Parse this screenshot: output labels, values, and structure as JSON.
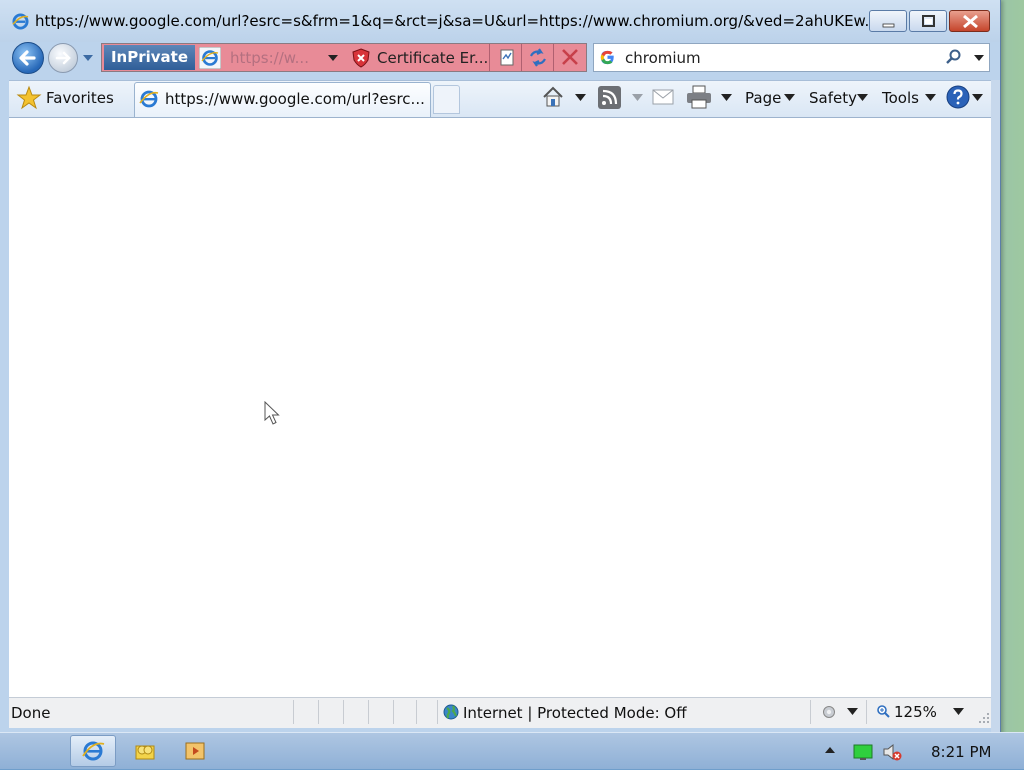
{
  "window": {
    "title": "https://www.google.com/url?esrc=s&frm=1&q=&rct=j&sa=U&url=https://www.chromium.org/&ved=2ahUKEw..."
  },
  "addressbar": {
    "inprivate_label": "InPrivate",
    "url": "https://w...",
    "cert_error": "Certificate Er..."
  },
  "search": {
    "value": "chromium"
  },
  "commandbar": {
    "favorites_label": "Favorites",
    "tab_label": "https://www.google.com/url?esrc...",
    "page_label": "Page",
    "safety_label": "Safety",
    "tools_label": "Tools"
  },
  "statusbar": {
    "status": "Done",
    "zone": "Internet | Protected Mode: Off",
    "zoom": "125%"
  },
  "taskbar": {
    "time": "8:21 PM"
  },
  "icons": [
    "ie-icon",
    "minimize-icon",
    "maximize-icon",
    "close-icon",
    "back-icon",
    "forward-icon",
    "certificate-error-icon",
    "compatibility-view-icon",
    "refresh-icon",
    "stop-icon",
    "google-icon",
    "search-icon",
    "star-icon",
    "home-icon",
    "rss-icon",
    "mail-icon",
    "print-icon",
    "help-icon",
    "globe-icon",
    "zoom-icon",
    "explorer-icon",
    "media-icon",
    "network-icon",
    "volume-muted-icon"
  ],
  "colors": {
    "addressbar_error": "#e88b97",
    "inprivate": "#2f5e98",
    "close_button": "#c5452c"
  }
}
